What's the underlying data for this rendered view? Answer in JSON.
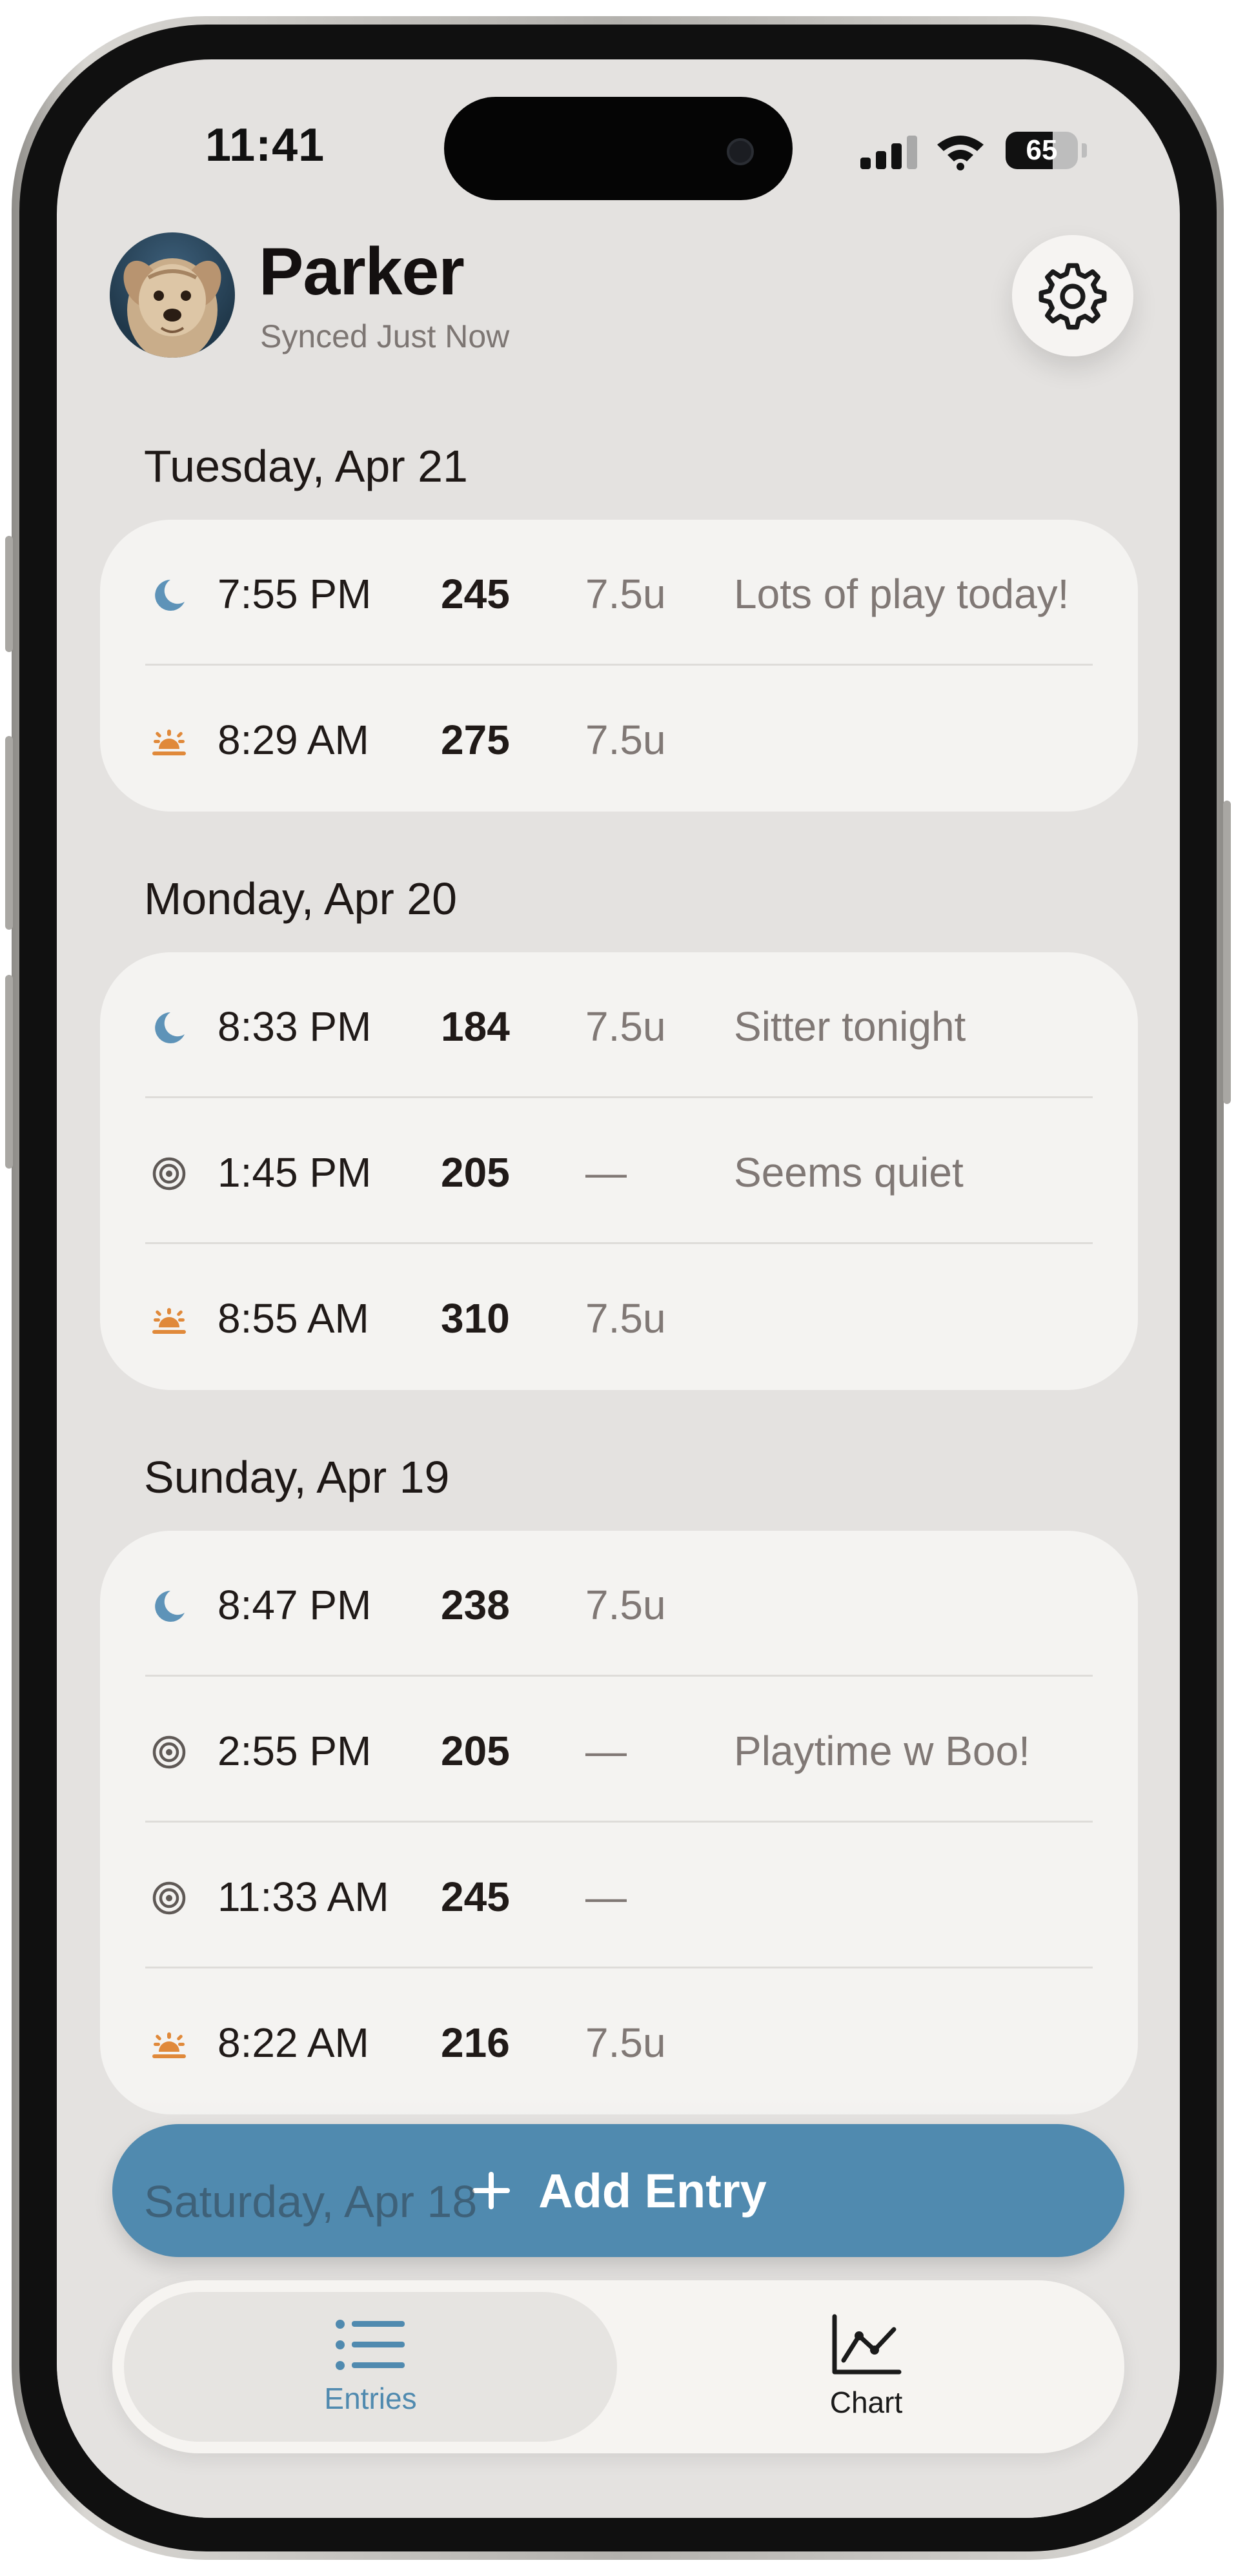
{
  "status_bar": {
    "time": "11:41",
    "battery_percent": "65",
    "signal_bars_active": 3,
    "signal_bars_total": 4
  },
  "header": {
    "pet_name": "Parker",
    "sync_status": "Synced Just Now",
    "settings_icon": "gear-icon"
  },
  "days": [
    {
      "heading": "Tuesday, Apr 21",
      "entries": [
        {
          "icon": "moon-icon",
          "time": "7:55 PM",
          "reading": "245",
          "dose": "7.5u",
          "note": "Lots of play today!"
        },
        {
          "icon": "sunrise-icon",
          "time": "8:29 AM",
          "reading": "275",
          "dose": "7.5u",
          "note": ""
        }
      ]
    },
    {
      "heading": "Monday, Apr 20",
      "entries": [
        {
          "icon": "moon-icon",
          "time": "8:33 PM",
          "reading": "184",
          "dose": "7.5u",
          "note": "Sitter tonight"
        },
        {
          "icon": "target-icon",
          "time": "1:45 PM",
          "reading": "205",
          "dose": "—",
          "note": "Seems quiet"
        },
        {
          "icon": "sunrise-icon",
          "time": "8:55 AM",
          "reading": "310",
          "dose": "7.5u",
          "note": ""
        }
      ]
    },
    {
      "heading": "Sunday, Apr 19",
      "entries": [
        {
          "icon": "moon-icon",
          "time": "8:47 PM",
          "reading": "238",
          "dose": "7.5u",
          "note": ""
        },
        {
          "icon": "target-icon",
          "time": "2:55 PM",
          "reading": "205",
          "dose": "—",
          "note": "Playtime w Boo!"
        },
        {
          "icon": "target-icon",
          "time": "11:33 AM",
          "reading": "245",
          "dose": "—",
          "note": ""
        },
        {
          "icon": "sunrise-icon",
          "time": "8:22 AM",
          "reading": "216",
          "dose": "7.5u",
          "note": ""
        }
      ]
    },
    {
      "heading": "Saturday, Apr 18",
      "entries": []
    }
  ],
  "actions": {
    "add_entry_label": "Add Entry",
    "add_icon": "plus-icon"
  },
  "tabs": [
    {
      "label": "Entries",
      "icon": "list-icon",
      "active": true
    },
    {
      "label": "Chart",
      "icon": "line-chart-icon",
      "active": false
    }
  ],
  "colors": {
    "accent": "#508aaf",
    "moon_icon": "#5e93b8",
    "sunrise_icon": "#e0893a",
    "target_icon": "#5f5956",
    "background": "#e4e2e0",
    "card": "#f4f3f1"
  }
}
